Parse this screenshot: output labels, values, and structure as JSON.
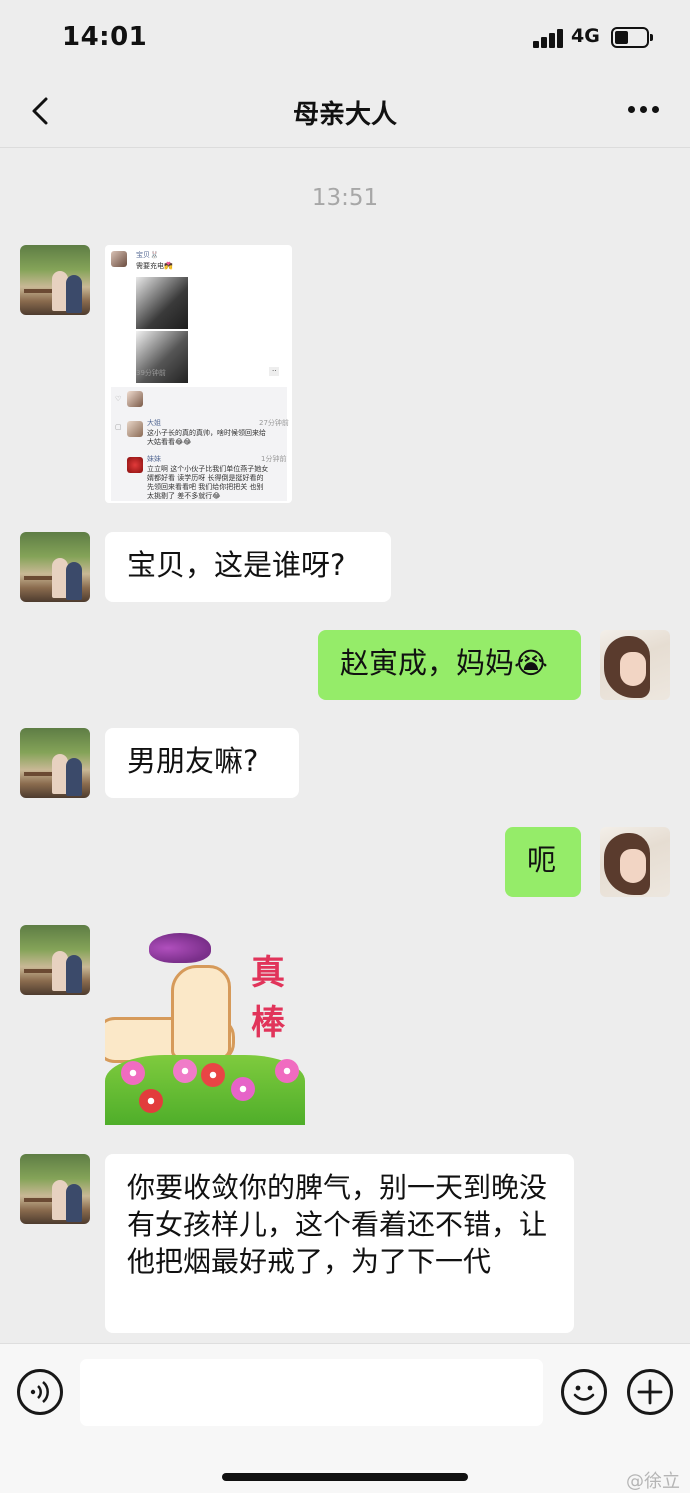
{
  "status_bar": {
    "time": "14:01",
    "network": "4G"
  },
  "nav": {
    "title": "母亲大人"
  },
  "chat": {
    "timestamp": "13:51",
    "messages": [
      {
        "side": "left",
        "text": "宝贝，这是谁呀?"
      },
      {
        "side": "right",
        "text": "赵寅成，妈妈😭"
      },
      {
        "side": "left",
        "text": "男朋友嘛?"
      },
      {
        "side": "right",
        "text": "呃"
      },
      {
        "side": "left",
        "text": "你要收敛你的脾气，别一天到晚没有女孩样儿，这个看着还不错，让他把烟最好戒了，为了下一代"
      }
    ]
  },
  "screenshot_image": {
    "post_name": "宝贝🐰",
    "post_text": "需要充电💏",
    "post_time": "39分钟前",
    "comments": [
      {
        "name": "大姐",
        "time": "27分钟前",
        "text": [
          "这小子长的真的真帅，啥时候领回来给",
          "大姑看看😂😂"
        ]
      },
      {
        "name": "妹妹",
        "time": "1分钟前",
        "text": [
          "立立啊  这个小伙子比我们单位燕子她女",
          "婿都好看  读学历呀  长得倒是挺好看的",
          "先领回来看看吧  我们给你把把关  也别",
          "太挑剔了  差不多就行😂"
        ]
      }
    ]
  },
  "sticker": {
    "text": "真棒"
  },
  "input": {
    "placeholder": ""
  },
  "watermark": "@徐立",
  "icons": [
    "back-icon",
    "more-icon",
    "voice-icon",
    "emoji-icon",
    "plus-icon"
  ]
}
